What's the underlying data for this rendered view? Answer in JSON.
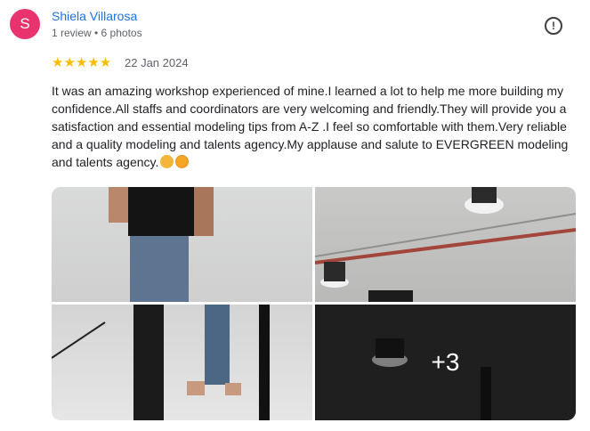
{
  "reviewer": {
    "initial": "S",
    "name": "Shiela Villarosa",
    "meta": "1 review • 6 photos",
    "avatar_color": "#e8336f"
  },
  "review": {
    "stars": "★★★★★",
    "rating": 5,
    "date": "22 Jan 2024",
    "text": "It was an amazing workshop experienced of mine.I learned a lot to help me more building my confidence.All staffs and coordinators are very welcoming and friendly.They will provide you a satisfaction and essential modeling tips from A-Z .I feel so comfortable with them.Very reliable and a quality modeling and talents agency.My applause and salute to EVERGREEN modeling and talents agency."
  },
  "icons": {
    "report": "report-icon",
    "emoji_1": "clapping-hands-emoji",
    "emoji_2": "face-blowing-kiss-emoji"
  },
  "photos": {
    "more_label": "+3"
  },
  "colors": {
    "name_link": "#1a73e8",
    "star": "#fbbc04"
  }
}
